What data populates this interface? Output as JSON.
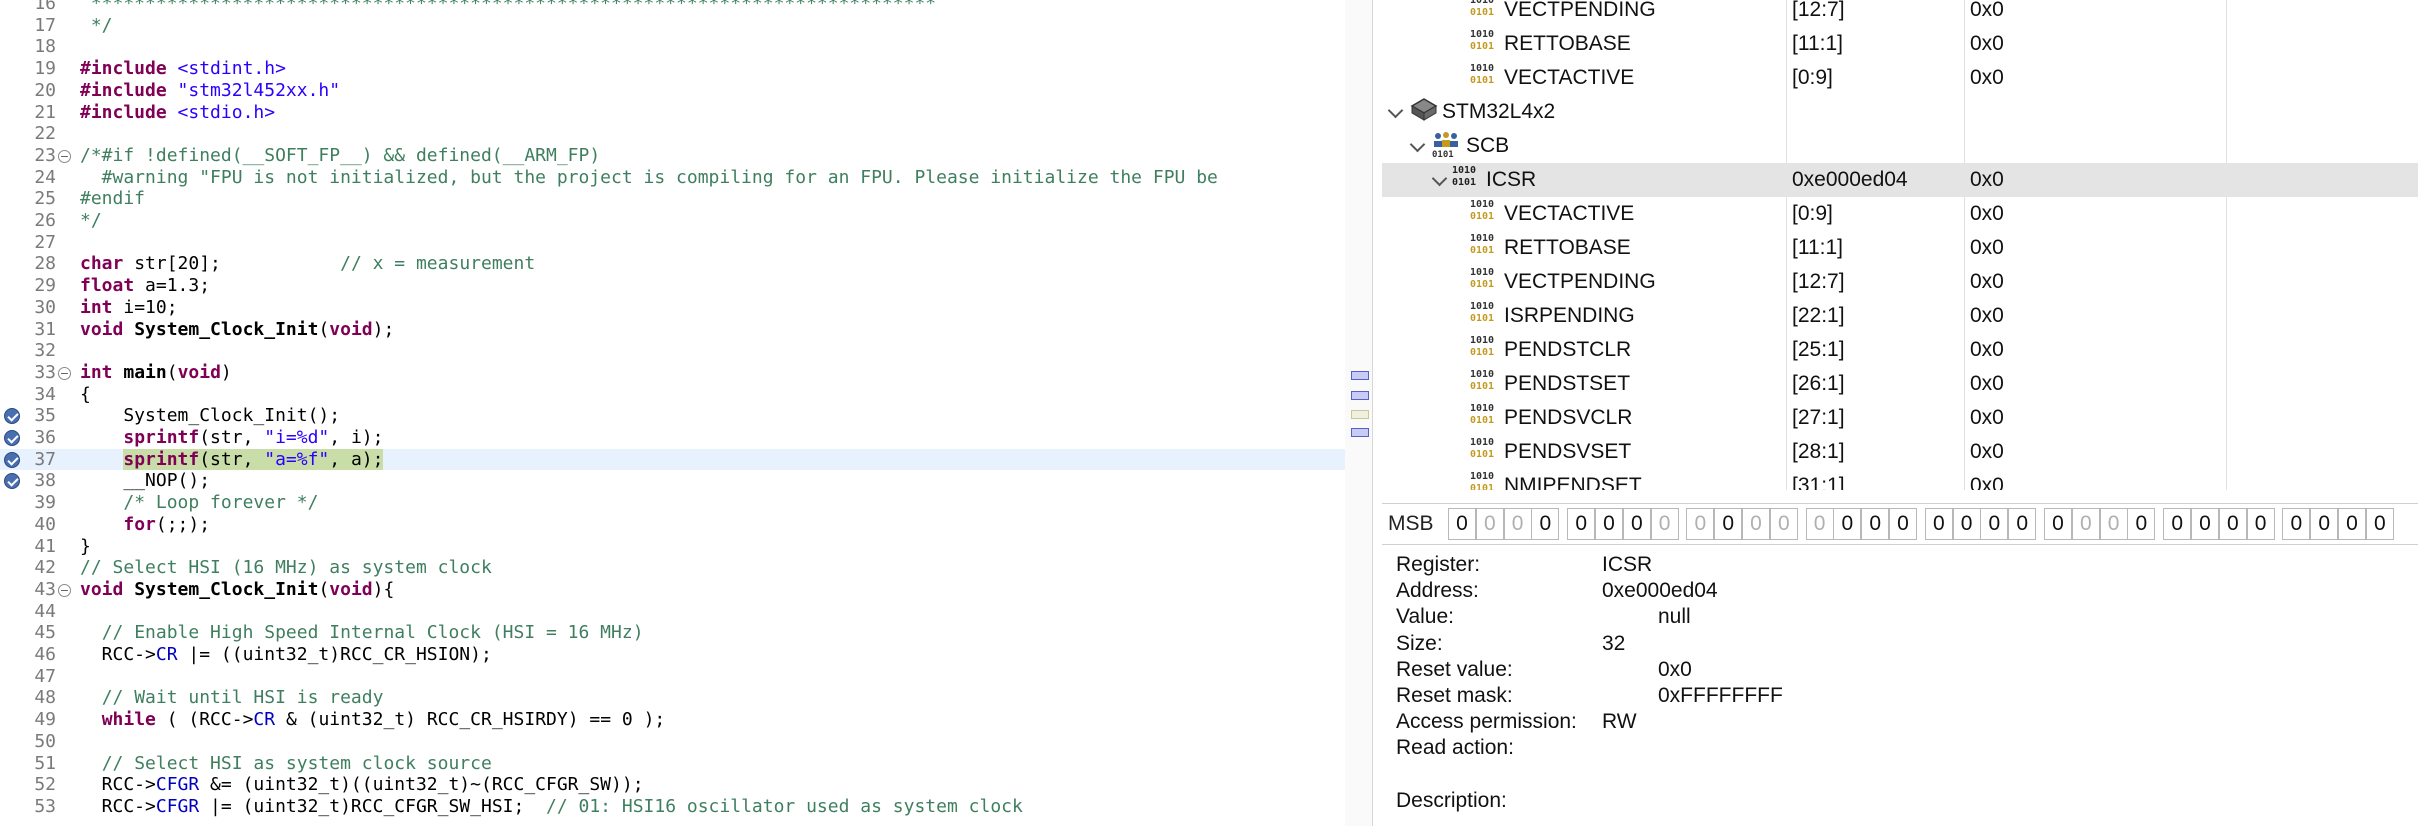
{
  "editor": {
    "lines": [
      {
        "n": "16",
        "segs": [
          {
            "c": "cmt",
            "t": " ******************************************************************************"
          }
        ]
      },
      {
        "n": "17",
        "segs": [
          {
            "c": "cmt",
            "t": " */"
          }
        ]
      },
      {
        "n": "18",
        "segs": []
      },
      {
        "n": "19",
        "segs": [
          {
            "c": "kw",
            "t": "#include"
          },
          {
            "c": "",
            "t": " "
          },
          {
            "c": "str",
            "t": "<stdint.h>"
          }
        ]
      },
      {
        "n": "20",
        "segs": [
          {
            "c": "kw",
            "t": "#include"
          },
          {
            "c": "",
            "t": " "
          },
          {
            "c": "str",
            "t": "\"stm32l452xx.h\""
          }
        ]
      },
      {
        "n": "21",
        "segs": [
          {
            "c": "kw",
            "t": "#include"
          },
          {
            "c": "",
            "t": " "
          },
          {
            "c": "str",
            "t": "<stdio.h>"
          }
        ]
      },
      {
        "n": "22",
        "segs": []
      },
      {
        "n": "23",
        "fold": true,
        "segs": [
          {
            "c": "cmt",
            "t": "/*#if !defined(__SOFT_FP__) && defined(__ARM_FP)"
          }
        ]
      },
      {
        "n": "24",
        "segs": [
          {
            "c": "cmt",
            "t": "  #warning \"FPU is not initialized, but the project is compiling for an FPU. Please initialize the FPU be"
          }
        ]
      },
      {
        "n": "25",
        "segs": [
          {
            "c": "cmt",
            "t": "#endif"
          }
        ]
      },
      {
        "n": "26",
        "segs": [
          {
            "c": "cmt",
            "t": "*/"
          }
        ]
      },
      {
        "n": "27",
        "segs": []
      },
      {
        "n": "28",
        "segs": [
          {
            "c": "kw",
            "t": "char"
          },
          {
            "c": "",
            "t": " str[20];           "
          },
          {
            "c": "cmt",
            "t": "// x = measurement"
          }
        ]
      },
      {
        "n": "29",
        "segs": [
          {
            "c": "kw",
            "t": "float"
          },
          {
            "c": "",
            "t": " a=1.3;"
          }
        ]
      },
      {
        "n": "30",
        "segs": [
          {
            "c": "kw",
            "t": "int"
          },
          {
            "c": "",
            "t": " i=10;"
          }
        ]
      },
      {
        "n": "31",
        "segs": [
          {
            "c": "kw",
            "t": "void"
          },
          {
            "c": "",
            "t": " "
          },
          {
            "c": "fn",
            "t": "System_Clock_Init"
          },
          {
            "c": "",
            "t": "("
          },
          {
            "c": "kw",
            "t": "void"
          },
          {
            "c": "",
            "t": ");"
          }
        ]
      },
      {
        "n": "32",
        "segs": []
      },
      {
        "n": "33",
        "fold": true,
        "segs": [
          {
            "c": "kw",
            "t": "int"
          },
          {
            "c": "",
            "t": " "
          },
          {
            "c": "fn",
            "t": "main"
          },
          {
            "c": "",
            "t": "("
          },
          {
            "c": "kw",
            "t": "void"
          },
          {
            "c": "",
            "t": ")"
          }
        ]
      },
      {
        "n": "34",
        "segs": [
          {
            "c": "",
            "t": "{"
          }
        ]
      },
      {
        "n": "35",
        "bp": true,
        "segs": [
          {
            "c": "",
            "t": "    System_Clock_Init();"
          }
        ]
      },
      {
        "n": "36",
        "bp": true,
        "segs": [
          {
            "c": "",
            "t": "    "
          },
          {
            "c": "kw",
            "t": "sprintf"
          },
          {
            "c": "",
            "t": "(str, "
          },
          {
            "c": "str",
            "t": "\"i=%d\""
          },
          {
            "c": "",
            "t": ", i);"
          }
        ]
      },
      {
        "n": "37",
        "bp": true,
        "current": true,
        "segs": [
          {
            "c": "",
            "t": "    "
          },
          {
            "c": "kw hl",
            "t": "sprintf"
          },
          {
            "c": "hl",
            "t": "(str, "
          },
          {
            "c": "str hl",
            "t": "\"a=%f\""
          },
          {
            "c": "hl",
            "t": ", a);"
          }
        ]
      },
      {
        "n": "38",
        "bp": true,
        "segs": [
          {
            "c": "",
            "t": "    __NOP();"
          }
        ]
      },
      {
        "n": "39",
        "segs": [
          {
            "c": "",
            "t": "    "
          },
          {
            "c": "cmt",
            "t": "/* Loop forever */"
          }
        ]
      },
      {
        "n": "40",
        "segs": [
          {
            "c": "",
            "t": "    "
          },
          {
            "c": "kw",
            "t": "for"
          },
          {
            "c": "",
            "t": "(;;);"
          }
        ]
      },
      {
        "n": "41",
        "segs": [
          {
            "c": "",
            "t": "}"
          }
        ]
      },
      {
        "n": "42",
        "segs": [
          {
            "c": "cmt",
            "t": "// Select HSI (16 MHz) as system clock"
          }
        ]
      },
      {
        "n": "43",
        "fold": true,
        "segs": [
          {
            "c": "kw",
            "t": "void"
          },
          {
            "c": "",
            "t": " "
          },
          {
            "c": "fn",
            "t": "System_Clock_Init"
          },
          {
            "c": "",
            "t": "("
          },
          {
            "c": "kw",
            "t": "void"
          },
          {
            "c": "",
            "t": "){"
          }
        ]
      },
      {
        "n": "44",
        "segs": []
      },
      {
        "n": "45",
        "segs": [
          {
            "c": "",
            "t": "  "
          },
          {
            "c": "cmt",
            "t": "// Enable High Speed Internal Clock (HSI = 16 MHz)"
          }
        ]
      },
      {
        "n": "46",
        "segs": [
          {
            "c": "",
            "t": "  RCC->"
          },
          {
            "c": "mac",
            "t": "CR"
          },
          {
            "c": "",
            "t": " |= ((uint32_t)RCC_CR_HSION);"
          }
        ]
      },
      {
        "n": "47",
        "segs": []
      },
      {
        "n": "48",
        "segs": [
          {
            "c": "",
            "t": "  "
          },
          {
            "c": "cmt",
            "t": "// Wait until HSI is ready"
          }
        ]
      },
      {
        "n": "49",
        "segs": [
          {
            "c": "",
            "t": "  "
          },
          {
            "c": "kw",
            "t": "while"
          },
          {
            "c": "",
            "t": " ( (RCC->"
          },
          {
            "c": "mac",
            "t": "CR"
          },
          {
            "c": "",
            "t": " & (uint32_t) RCC_CR_HSIRDY) == 0 );"
          }
        ]
      },
      {
        "n": "50",
        "segs": []
      },
      {
        "n": "51",
        "segs": [
          {
            "c": "",
            "t": "  "
          },
          {
            "c": "cmt",
            "t": "// Select HSI as system clock source"
          }
        ]
      },
      {
        "n": "52",
        "segs": [
          {
            "c": "",
            "t": "  RCC->"
          },
          {
            "c": "mac",
            "t": "CFGR"
          },
          {
            "c": "",
            "t": " &= (uint32_t)((uint32_t)~(RCC_CFGR_SW));"
          }
        ]
      },
      {
        "n": "53",
        "segs": [
          {
            "c": "",
            "t": "  RCC->"
          },
          {
            "c": "mac",
            "t": "CFGR"
          },
          {
            "c": "",
            "t": " |= (uint32_t)RCC_CFGR_SW_HSI;  "
          },
          {
            "c": "cmt",
            "t": "// 01: HSI16 oscillator used as system clock"
          }
        ]
      }
    ]
  },
  "registers": {
    "tree": [
      {
        "kind": "field",
        "depth": 3,
        "name": "VECTPENDING",
        "addr": "[12:7]",
        "value": "0x0"
      },
      {
        "kind": "field",
        "depth": 3,
        "name": "RETTOBASE",
        "addr": "[11:1]",
        "value": "0x0"
      },
      {
        "kind": "field",
        "depth": 3,
        "name": "VECTACTIVE",
        "addr": "[0:9]",
        "value": "0x0"
      },
      {
        "kind": "device",
        "depth": 0,
        "name": "STM32L4x2",
        "addr": "",
        "value": "",
        "expanded": true
      },
      {
        "kind": "group",
        "depth": 1,
        "name": "SCB",
        "addr": "",
        "value": "",
        "expanded": true
      },
      {
        "kind": "register",
        "depth": 2,
        "name": "ICSR",
        "addr": "0xe000ed04",
        "value": "0x0",
        "expanded": true,
        "selected": true
      },
      {
        "kind": "field",
        "depth": 3,
        "name": "VECTACTIVE",
        "addr": "[0:9]",
        "value": "0x0"
      },
      {
        "kind": "field",
        "depth": 3,
        "name": "RETTOBASE",
        "addr": "[11:1]",
        "value": "0x0"
      },
      {
        "kind": "field",
        "depth": 3,
        "name": "VECTPENDING",
        "addr": "[12:7]",
        "value": "0x0"
      },
      {
        "kind": "field",
        "depth": 3,
        "name": "ISRPENDING",
        "addr": "[22:1]",
        "value": "0x0"
      },
      {
        "kind": "field",
        "depth": 3,
        "name": "PENDSTCLR",
        "addr": "[25:1]",
        "value": "0x0"
      },
      {
        "kind": "field",
        "depth": 3,
        "name": "PENDSTSET",
        "addr": "[26:1]",
        "value": "0x0"
      },
      {
        "kind": "field",
        "depth": 3,
        "name": "PENDSVCLR",
        "addr": "[27:1]",
        "value": "0x0"
      },
      {
        "kind": "field",
        "depth": 3,
        "name": "PENDSVSET",
        "addr": "[28:1]",
        "value": "0x0"
      },
      {
        "kind": "field",
        "depth": 3,
        "name": "NMIPENDSET",
        "addr": "[31:1]",
        "value": "0x0"
      }
    ],
    "bits": {
      "label": "MSB",
      "groups": [
        [
          "0",
          "0",
          "0",
          "0"
        ],
        [
          "0",
          "0",
          "0",
          "0"
        ],
        [
          "0",
          "0",
          "0",
          "0"
        ],
        [
          "0",
          "0",
          "0",
          "0"
        ],
        [
          "0",
          "0",
          "0",
          "0"
        ],
        [
          "0",
          "0",
          "0",
          "0"
        ],
        [
          "0",
          "0",
          "0",
          "0"
        ],
        [
          "0",
          "0",
          "0",
          "0"
        ]
      ],
      "readonly": [
        false,
        true,
        true,
        false,
        false,
        false,
        false,
        true,
        true,
        false,
        true,
        true,
        true,
        false,
        false,
        false,
        false,
        false,
        false,
        false,
        false,
        true,
        true,
        false,
        false,
        false,
        false,
        false
      ]
    },
    "details": [
      {
        "key": "Register:",
        "value": "ICSR",
        "indent": false
      },
      {
        "key": "Address:",
        "value": "0xe000ed04",
        "indent": false
      },
      {
        "key": "Value:",
        "value": "null",
        "indent": true
      },
      {
        "key": "Size:",
        "value": "32",
        "indent": false
      },
      {
        "key": "Reset value:",
        "value": "0x0",
        "indent": true
      },
      {
        "key": "Reset mask:",
        "value": "0xFFFFFFFF",
        "indent": true
      },
      {
        "key": "Access permission:",
        "value": "RW",
        "indent": false
      },
      {
        "key": "Read action:",
        "value": "",
        "indent": false
      },
      {
        "key": "",
        "value": "",
        "indent": false
      },
      {
        "key": "Description:",
        "value": "",
        "indent": false
      }
    ]
  }
}
